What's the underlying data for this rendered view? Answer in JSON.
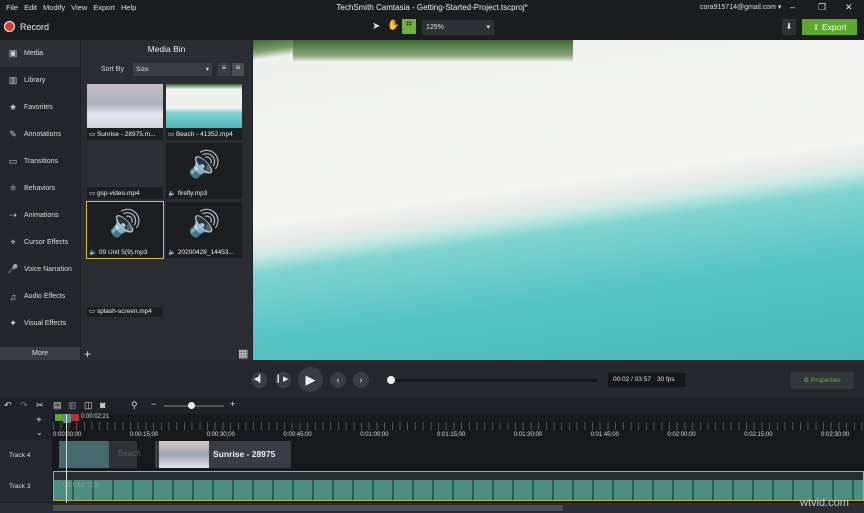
{
  "menu": [
    "File",
    "Edit",
    "Modify",
    "View",
    "Export",
    "Help"
  ],
  "window_title": "TechSmith Camtasia - Getting-Started-Project.tscproj*",
  "account": "cora915714@gmail.com",
  "toolbar": {
    "record": "Record",
    "zoom": "125%",
    "export": "Export"
  },
  "sidebar": {
    "items": [
      "Media",
      "Library",
      "Favorites",
      "Annotations",
      "Transitions",
      "Behaviors",
      "Animations",
      "Cursor Effects",
      "Voice Narration",
      "Audio Effects",
      "Visual Effects"
    ],
    "more": "More"
  },
  "bin": {
    "title": "Media Bin",
    "sort_label": "Sort By",
    "sort_value": "Size",
    "items": [
      "Sunrise - 28975.m...",
      "Beach - 41352.mp4",
      "gsp-video.mp4",
      "firefly.mp3",
      "09 Unit 5(9).mp3",
      "20200428_14453...",
      "splash-screen.mp4"
    ]
  },
  "playback": {
    "time": "00:02 / 03:57",
    "fps": "30 fps",
    "properties": "Properties",
    "progress": 0.01
  },
  "timeline": {
    "playhead": "0:00:02;21",
    "ticks": [
      "0:00:00;00",
      "0:00:15;00",
      "0:00:30;00",
      "0:00:45;00",
      "0:01:00;00",
      "0:01:15;00",
      "0:01:30;00",
      "0:01:45;00",
      "0:02:00;00",
      "0:02:15;00",
      "0:02:30;00"
    ],
    "tracks": [
      {
        "name": "Track 4",
        "clips": [
          "Beach",
          "Sunrise - 28975"
        ]
      },
      {
        "name": "Track 3",
        "clips": [
          "09 Unit 5(9)"
        ]
      }
    ]
  },
  "watermark": "wtvid.com"
}
